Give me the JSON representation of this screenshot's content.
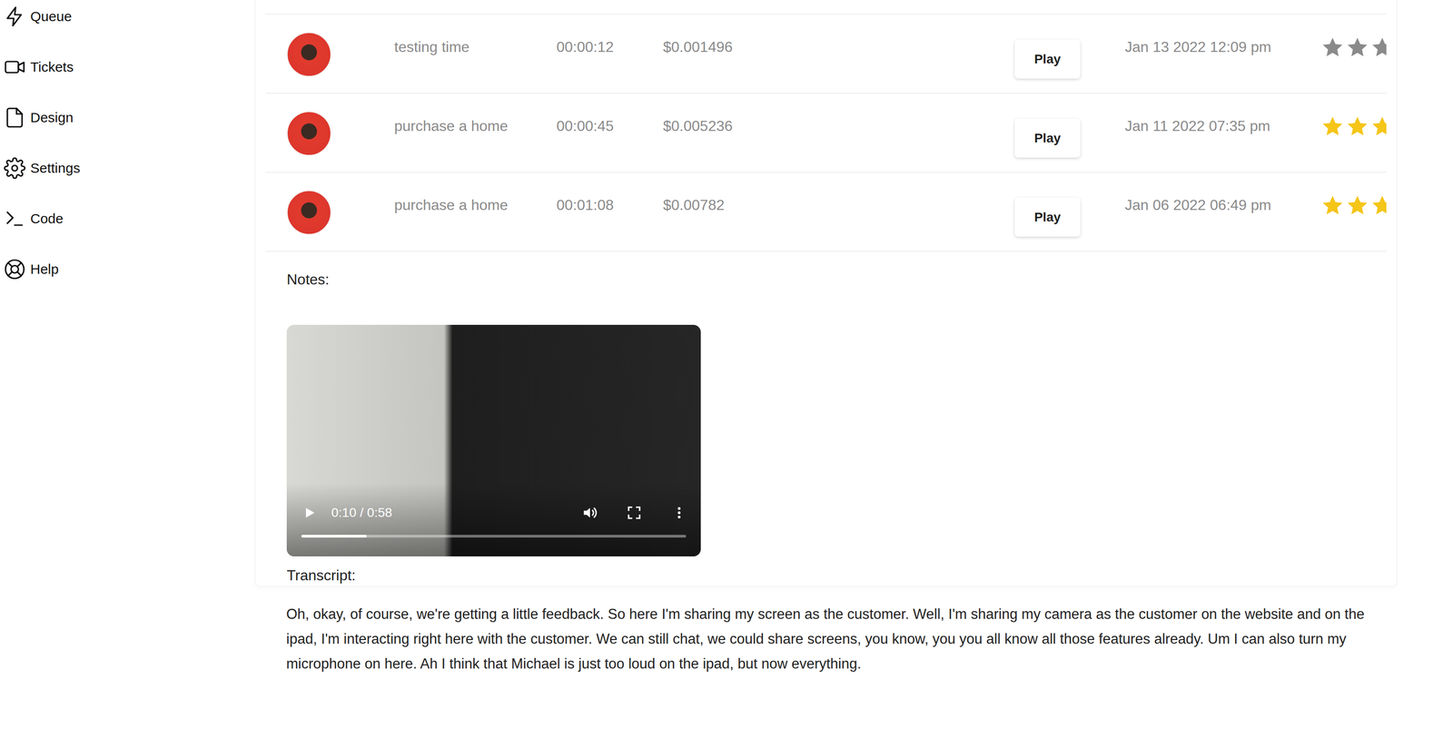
{
  "sidebar": {
    "items": [
      {
        "label": "Queue"
      },
      {
        "label": "Tickets"
      },
      {
        "label": "Design"
      },
      {
        "label": "Settings"
      },
      {
        "label": "Code"
      },
      {
        "label": "Help"
      }
    ]
  },
  "table": {
    "rows": [
      {
        "title": "testing time",
        "duration": "00:00:12",
        "cost": "$0.001496",
        "button": "Play",
        "date": "Jan 13 2022 12:09 pm",
        "stars": 0
      },
      {
        "title": "purchase a home",
        "duration": "00:00:45",
        "cost": "$0.005236",
        "button": "Play",
        "date": "Jan 11 2022 07:35 pm",
        "stars": 3
      },
      {
        "title": "purchase a home",
        "duration": "00:01:08",
        "cost": "$0.00782",
        "button": "Play",
        "date": "Jan 06 2022 06:49 pm",
        "stars": 3
      }
    ]
  },
  "notes": {
    "label": "Notes:"
  },
  "video": {
    "time": "0:10 / 0:58",
    "level": 0.17
  },
  "transcript": {
    "label": "Transcript:",
    "text": "Oh, okay, of course, we're getting a little feedback. So here I'm sharing my screen as the customer. Well, I'm sharing my camera as the customer on the website and on the ipad, I'm interacting right here with the customer. We can still chat, we could share screens, you know, you you all know all those features already. Um I can also turn my microphone on here. Ah I think that Michael is just too loud on the ipad, but now everything."
  }
}
